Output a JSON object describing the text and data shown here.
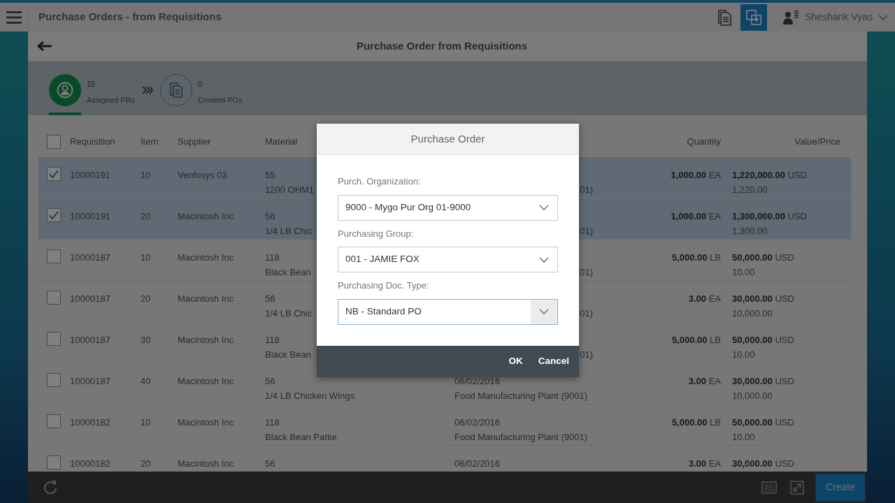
{
  "top_bar": {
    "title": "Purchase Orders - from Requisitions",
    "user": "Sheshank Vyas",
    "buttons": [
      {
        "kind": "document",
        "selected": false
      },
      {
        "kind": "copy",
        "selected": true
      }
    ]
  },
  "page": {
    "title": "Purchase Order from Requisitions"
  },
  "process_flow": [
    {
      "kind": "person",
      "count": "15",
      "label": "Assigned PRs",
      "selected": true
    },
    {
      "kind": "document",
      "count": "0",
      "label": "Created POs",
      "selected": false
    }
  ],
  "table": {
    "all_selected": false,
    "columns": [
      "Requisition",
      "Item",
      "Supplier",
      "Material",
      "Quantity",
      "Value/Price"
    ],
    "rows": [
      {
        "selected": true,
        "requisition": "10000191",
        "item": "10",
        "supplier": "Venfosys 03",
        "material": "55",
        "material_text": "1200 OHM1",
        "plant": "01)",
        "quantity": "1,000.00",
        "unit": "EA",
        "value": "1,220,000.00",
        "currency": "USD",
        "price": "1,220.00"
      },
      {
        "selected": true,
        "requisition": "10000191",
        "item": "20",
        "supplier": "Macintosh Inc",
        "material": "56",
        "material_text": "1/4 LB Chic",
        "plant": "01)",
        "quantity": "1,000.00",
        "unit": "EA",
        "value": "1,300,000.00",
        "currency": "USD",
        "price": "1,300.00"
      },
      {
        "selected": false,
        "requisition": "10000187",
        "item": "10",
        "supplier": "Macintosh Inc",
        "material": "118",
        "material_text": "Black Bean",
        "plant": "01)",
        "quantity": "5,000.00",
        "unit": "LB",
        "value": "50,000.00",
        "currency": "USD",
        "price": "10.00"
      },
      {
        "selected": false,
        "requisition": "10000187",
        "item": "20",
        "supplier": "Macintosh Inc",
        "material": "56",
        "material_text": "1/4 LB Chic",
        "plant": "01)",
        "quantity": "3.00",
        "unit": "EA",
        "value": "30,000.00",
        "currency": "USD",
        "price": "10,000.00"
      },
      {
        "selected": false,
        "requisition": "10000187",
        "item": "30",
        "supplier": "Macintosh Inc",
        "material": "118",
        "material_text": "Black Bean",
        "plant": "01)",
        "quantity": "5,000.00",
        "unit": "LB",
        "value": "50,000.00",
        "currency": "USD",
        "price": "10.00"
      },
      {
        "selected": false,
        "requisition": "10000187",
        "item": "40",
        "supplier": "Macintosh Inc",
        "material": "56",
        "material_text": "1/4 LB Chicken Wings",
        "date": "06/02/2016",
        "plant": "Food Manufacturing Plant (9001)",
        "quantity": "3.00",
        "unit": "EA",
        "value": "30,000.00",
        "currency": "USD",
        "price": "10,000.00"
      },
      {
        "selected": false,
        "requisition": "10000182",
        "item": "10",
        "supplier": "Macintosh Inc",
        "material": "118",
        "material_text": "Black Bean Pattie",
        "date": "06/02/2016",
        "plant": "Food Manufacturing Plant (9001)",
        "quantity": "5,000.00",
        "unit": "LB",
        "value": "50,000.00",
        "currency": "USD",
        "price": "10.00"
      },
      {
        "selected": false,
        "requisition": "10000182",
        "item": "20",
        "supplier": "Macintosh Inc",
        "material": "56",
        "date": "06/02/2016",
        "quantity": "3.00",
        "unit": "EA",
        "value": "30,000.00",
        "currency": "USD"
      }
    ]
  },
  "dialog": {
    "title": "Purchase Order",
    "fields": [
      {
        "label": "Purch. Organization:",
        "value": "9000 - Mygo Pur Org 01-9000",
        "hovered": false
      },
      {
        "label": "Purchasing Group:",
        "value": "001 - JAMIE FOX",
        "hovered": false
      },
      {
        "label": "Purchasing Doc. Type:",
        "value": "NB - Standard PO",
        "hovered": true
      }
    ],
    "buttons": [
      "OK",
      "Cancel"
    ]
  },
  "footer": {
    "create": "Create"
  }
}
